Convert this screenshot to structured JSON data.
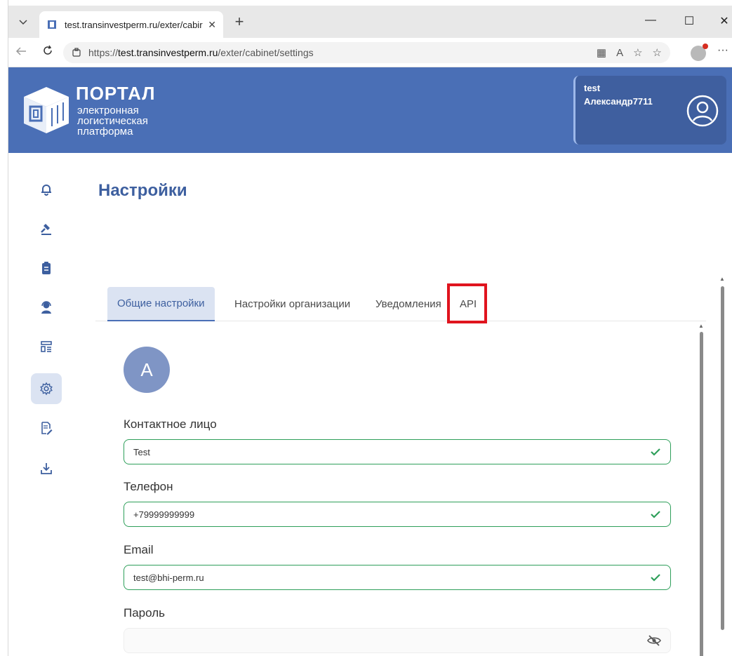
{
  "browser": {
    "tab_title": "test.transinvestperm.ru/exter/cabir",
    "tab_close": "✕",
    "new_tab": "+",
    "url_prefix": "https://",
    "url_host": "test.transinvestperm.ru",
    "url_path": "/exter/cabinet/settings",
    "minimize": "—",
    "maximize": "☐",
    "close": "✕",
    "more": "···"
  },
  "header": {
    "brand_title": "ПОРТАЛ",
    "brand_line1": "электронная",
    "brand_line2": "логистическая",
    "brand_line3": "платформа",
    "user_line1": "test",
    "user_line2": "Александр7711",
    "accent": "#4a6fb6"
  },
  "page": {
    "title": "Настройки"
  },
  "tabs": [
    {
      "label": "Общие настройки",
      "active": true
    },
    {
      "label": "Настройки организации",
      "active": false
    },
    {
      "label": "Уведомления",
      "active": false
    },
    {
      "label": "API",
      "active": false
    }
  ],
  "profile": {
    "avatar_letter": "A"
  },
  "form": {
    "contact_label": "Контактное лицо",
    "contact_value": "Test",
    "phone_label": "Телефон",
    "phone_value": "+79999999999",
    "email_label": "Email",
    "email_value": "test@bhi-perm.ru",
    "password_label": "Пароль",
    "password_value": ""
  },
  "colors": {
    "valid": "#2e9f5a",
    "highlight": "#e0141e"
  }
}
